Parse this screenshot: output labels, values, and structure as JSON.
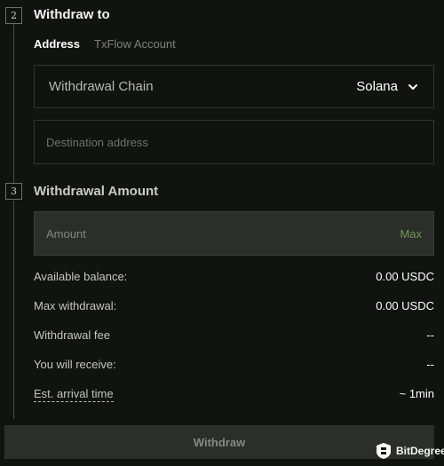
{
  "steps": {
    "withdraw_to": {
      "number": "2",
      "title": "Withdraw to"
    },
    "amount": {
      "number": "3",
      "title": "Withdrawal Amount"
    }
  },
  "tabs": [
    {
      "label": "Address",
      "active": true
    },
    {
      "label": "TxFlow Account",
      "active": false
    }
  ],
  "chain_select": {
    "label": "Withdrawal Chain",
    "value": "Solana"
  },
  "destination": {
    "placeholder": "Destination address",
    "value": ""
  },
  "amount": {
    "placeholder": "Amount",
    "value": "",
    "max_label": "Max"
  },
  "info": {
    "available": {
      "label": "Available balance:",
      "value": "0.00 USDC"
    },
    "max_withdrawal": {
      "label": "Max withdrawal:",
      "value": "0.00 USDC"
    },
    "fee": {
      "label": "Withdrawal fee",
      "value": "--"
    },
    "receive": {
      "label": "You will receive:",
      "value": "--"
    },
    "arrival": {
      "label": "Est. arrival time",
      "value": "~ 1min"
    }
  },
  "submit": {
    "label": "Withdraw"
  },
  "watermark": {
    "text": "BitDegree",
    "icon": "bitdegree-shield-logo"
  },
  "colors": {
    "accent": "#6f9a52",
    "background": "#11130f",
    "field_filled": "#2b2e29"
  }
}
